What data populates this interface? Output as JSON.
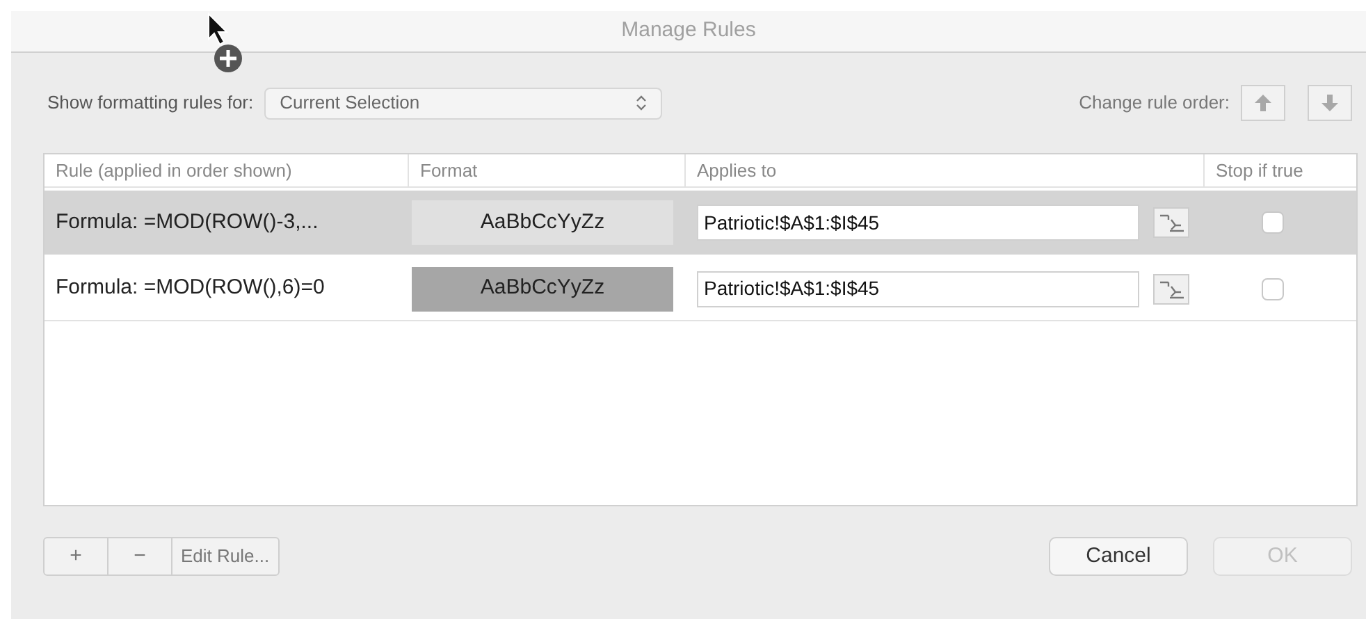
{
  "window": {
    "title": "Manage Rules"
  },
  "show_rules_for": {
    "label": "Show formatting rules for:",
    "value": "Current Selection"
  },
  "rule_order": {
    "label": "Change rule order:",
    "buttons": [
      {
        "kind": "up",
        "disabled": true
      },
      {
        "kind": "down",
        "disabled": true
      }
    ]
  },
  "table": {
    "columns": [
      "Rule (applied in order shown)",
      "Format",
      "Applies to",
      "Stop if true"
    ],
    "rows": [
      {
        "rule": "Formula: =MOD(ROW()-3,...",
        "format": "AaBbCcYyZz",
        "color": "#e0e0e0",
        "applies_to": "Patriotic!$A$1:$I$45",
        "stop_if_true": false,
        "selected": true
      },
      {
        "rule": "Formula: =MOD(ROW(),6)=0",
        "format": "AaBbCcYyZz",
        "color": "#a6a6a6",
        "applies_to": "Patriotic!$A$1:$I$45",
        "stop_if_true": false,
        "selected": false
      }
    ]
  },
  "edit_buttons": [
    "+",
    "−",
    "Edit Rule..."
  ],
  "dialog_buttons": [
    {
      "label": "Cancel",
      "disabled": false
    },
    {
      "label": "OK",
      "disabled": true
    }
  ]
}
